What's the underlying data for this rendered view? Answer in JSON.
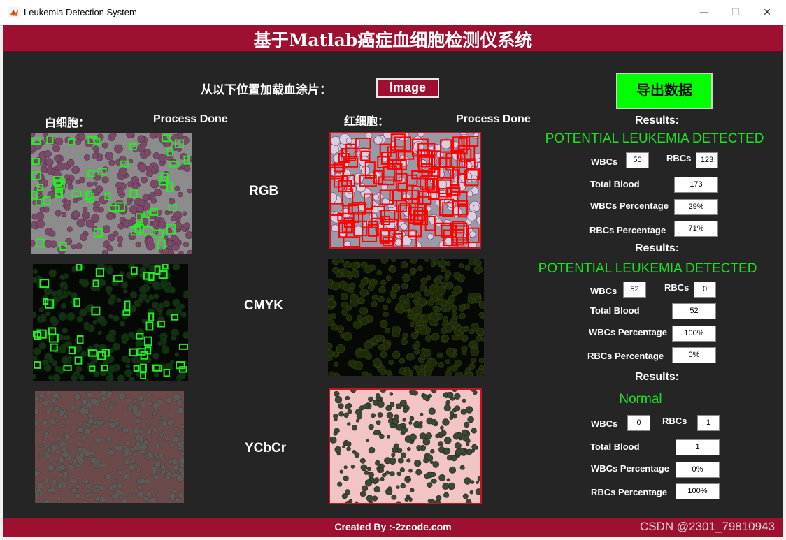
{
  "window": {
    "title": "Leukemia Detection System",
    "minimize": "—",
    "maximize": "☐",
    "close": "✕"
  },
  "header": {
    "title": "基于Matlab癌症血细胞检测仪系统"
  },
  "load": {
    "label": "从以下位置加载血涂片：",
    "button": "Image"
  },
  "export": {
    "label": "导出数据"
  },
  "wbc": {
    "label": "白细胞：",
    "status": "Process Done"
  },
  "rbc": {
    "label": "红细胞：",
    "status": "Process Done"
  },
  "colorspaces": [
    "RGB",
    "CMYK",
    "YCbCr"
  ],
  "results": [
    {
      "heading": "Results:",
      "status": "POTENTIAL LEUKEMIA DETECTED",
      "wbcs_label": "WBCs",
      "wbcs": "50",
      "rbcs_label": "RBCs",
      "rbcs": "123",
      "total_label": "Total Blood",
      "total": "173",
      "wbc_pct_label": "WBCs Percentage",
      "wbc_pct": "29%",
      "rbc_pct_label": "RBCs Percentage",
      "rbc_pct": "71%"
    },
    {
      "heading": "Results:",
      "status": "POTENTIAL LEUKEMIA DETECTED",
      "wbcs_label": "WBCs",
      "wbcs": "52",
      "rbcs_label": "RBCs",
      "rbcs": "0",
      "total_label": "Total Blood",
      "total": "52",
      "wbc_pct_label": "WBCs Percentage",
      "wbc_pct": "100%",
      "rbc_pct_label": "RBCs Percentage",
      "rbc_pct": "0%"
    },
    {
      "heading": "Results:",
      "status": "Normal",
      "wbcs_label": "WBCs",
      "wbcs": "0",
      "rbcs_label": "RBCs",
      "rbcs": "1",
      "total_label": "Total Blood",
      "total": "1",
      "wbc_pct_label": "WBCs Percentage",
      "wbc_pct": "0%",
      "rbc_pct_label": "RBCs Percentage",
      "rbc_pct": "100%"
    }
  ],
  "footer": {
    "created": "Created By :-2zcode.com",
    "watermark": "CSDN @2301_79810943"
  },
  "colors": {
    "accent": "#9e1030",
    "background": "#252525",
    "detect_green": "#1ee21e",
    "button_green": "#00ff00"
  }
}
